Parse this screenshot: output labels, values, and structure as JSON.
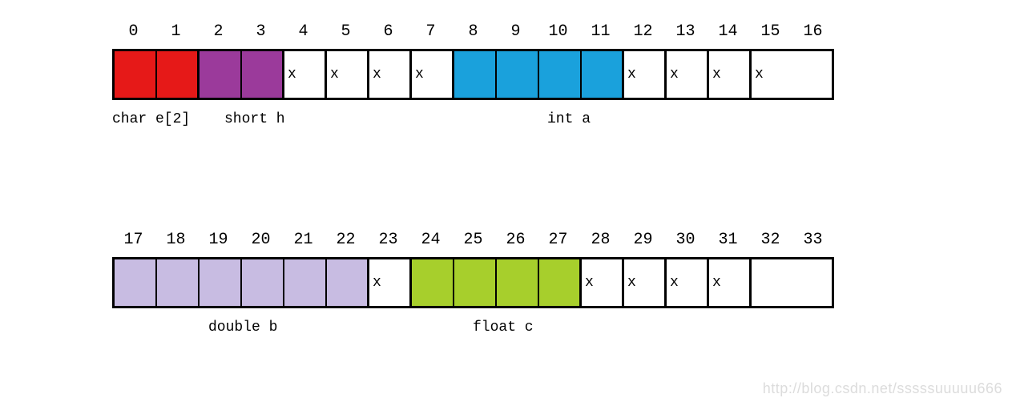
{
  "chart_data": {
    "type": "table",
    "title": "Memory layout / struct alignment diagram",
    "rows": [
      {
        "indices": [
          "0",
          "1",
          "2",
          "3",
          "4",
          "5",
          "6",
          "7",
          "8",
          "9",
          "10",
          "11",
          "12",
          "13",
          "14",
          "15",
          "16"
        ],
        "cells": [
          {
            "color": "red",
            "text": ""
          },
          {
            "color": "red",
            "text": ""
          },
          {
            "color": "purple",
            "text": ""
          },
          {
            "color": "purple",
            "text": ""
          },
          {
            "color": "white",
            "text": "x"
          },
          {
            "color": "white",
            "text": "x"
          },
          {
            "color": "white",
            "text": "x"
          },
          {
            "color": "white",
            "text": "x"
          },
          {
            "color": "blue",
            "text": ""
          },
          {
            "color": "blue",
            "text": ""
          },
          {
            "color": "blue",
            "text": ""
          },
          {
            "color": "blue",
            "text": ""
          },
          {
            "color": "white",
            "text": "x"
          },
          {
            "color": "white",
            "text": "x"
          },
          {
            "color": "white",
            "text": "x"
          },
          {
            "color": "white",
            "text": "x"
          }
        ],
        "labels": [
          {
            "text": "char e[2]",
            "offset_cells": 0,
            "width_cells": 2.5
          },
          {
            "text": "short h",
            "offset_cells": 2.5,
            "width_cells": 6
          },
          {
            "text": "int a",
            "offset_cells": 8.9,
            "width_cells": 4
          }
        ],
        "tight_groups": [
          [
            0,
            1
          ],
          [
            2,
            3
          ],
          [
            8,
            9,
            10,
            11
          ]
        ]
      },
      {
        "indices": [
          "17",
          "18",
          "19",
          "20",
          "21",
          "22",
          "23",
          "24",
          "25",
          "26",
          "27",
          "28",
          "29",
          "30",
          "31",
          "32",
          "33"
        ],
        "cells": [
          {
            "color": "lav",
            "text": ""
          },
          {
            "color": "lav",
            "text": ""
          },
          {
            "color": "lav",
            "text": ""
          },
          {
            "color": "lav",
            "text": ""
          },
          {
            "color": "lav",
            "text": ""
          },
          {
            "color": "lav",
            "text": ""
          },
          {
            "color": "white",
            "text": "x"
          },
          {
            "color": "green",
            "text": ""
          },
          {
            "color": "green",
            "text": ""
          },
          {
            "color": "green",
            "text": ""
          },
          {
            "color": "green",
            "text": ""
          },
          {
            "color": "white",
            "text": "x"
          },
          {
            "color": "white",
            "text": "x"
          },
          {
            "color": "white",
            "text": "x"
          },
          {
            "color": "white",
            "text": "x"
          },
          {
            "color": "white",
            "text": ""
          }
        ],
        "labels": [
          {
            "text": "double b",
            "offset_cells": 2.2,
            "width_cells": 6
          },
          {
            "text": "float c",
            "offset_cells": 8.5,
            "width_cells": 4
          }
        ],
        "tight_groups": [
          [
            0,
            1,
            2,
            3,
            4,
            5
          ],
          [
            7,
            8,
            9,
            10
          ]
        ]
      }
    ]
  },
  "watermark": "http://blog.csdn.net/sssssuuuuu666"
}
